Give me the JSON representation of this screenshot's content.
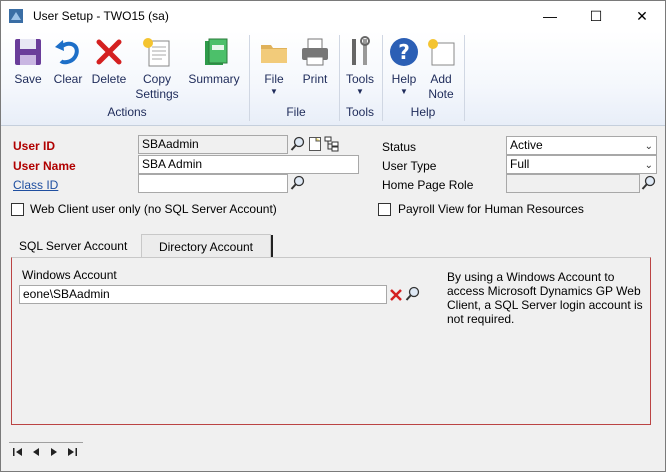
{
  "window": {
    "title": "User Setup  -  TWO15 (sa)",
    "minimize_glyph": "—",
    "maximize_glyph": "☐",
    "close_glyph": "✕"
  },
  "ribbon": {
    "actions": {
      "group_label": "Actions",
      "save": "Save",
      "clear": "Clear",
      "delete": "Delete",
      "copy_line1": "Copy",
      "copy_line2": "Settings",
      "summary": "Summary"
    },
    "file": {
      "group_label": "File",
      "file": "File",
      "print": "Print"
    },
    "tools": {
      "group_label": "Tools",
      "tools": "Tools"
    },
    "help": {
      "group_label": "Help",
      "help": "Help",
      "add_note_line1": "Add",
      "add_note_line2": "Note"
    },
    "dropdown_glyph": "▼"
  },
  "form": {
    "user_id_label": "User ID",
    "user_id_value": "SBAadmin",
    "user_name_label": "User Name",
    "user_name_value": "SBA Admin",
    "class_id_label": "Class ID",
    "class_id_value": "",
    "status_label": "Status",
    "status_value": "Active",
    "user_type_label": "User Type",
    "user_type_value": "Full",
    "home_page_role_label": "Home Page Role",
    "home_page_role_value": "",
    "web_client_checkbox_label": "Web Client user only (no SQL Server Account)",
    "payroll_view_checkbox_label": "Payroll View for Human Resources"
  },
  "tabs": {
    "sql_server": "SQL Server Account",
    "directory": "Directory Account"
  },
  "panel": {
    "windows_account_label": "Windows Account",
    "windows_account_value": "eone\\SBAadmin",
    "info_text": "By using a Windows Account to access Microsoft Dynamics GP Web Client, a SQL Server login account is not required."
  },
  "colors": {
    "required_label": "#b00000",
    "link": "#1f4fa0",
    "ribbon_text": "#1e2b5a"
  },
  "icons": [
    "app-icon",
    "save-icon",
    "clear-icon",
    "delete-icon",
    "copy-settings-icon",
    "summary-icon",
    "file-icon",
    "print-icon",
    "tools-icon",
    "help-icon",
    "add-note-icon",
    "lookup-icon",
    "new-note-icon",
    "hierarchy-icon",
    "clear-x-icon",
    "first-record-icon",
    "previous-record-icon",
    "next-record-icon",
    "last-record-icon"
  ]
}
